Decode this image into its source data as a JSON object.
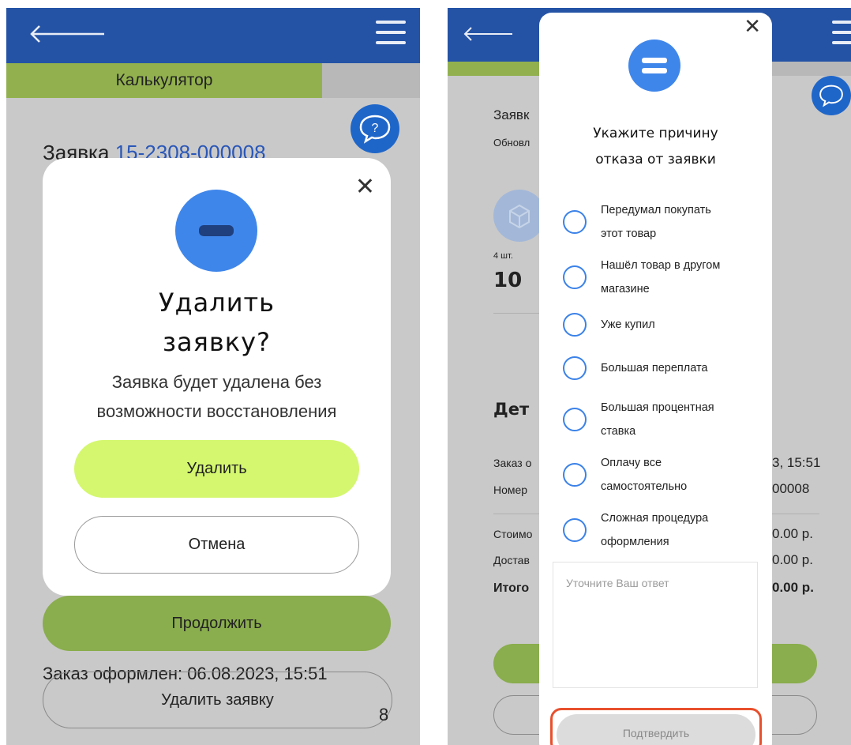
{
  "left": {
    "header": {
      "back_icon": "arrow-left-icon",
      "menu_icon": "hamburger-menu-icon"
    },
    "calc_tab": "Калькулятор",
    "bg": {
      "order_prefix": "Заявка",
      "order_number": "15-2308-000008",
      "continue_label": "Продолжить",
      "order_placed_fragment": "Заказ оформлен: 06.08.2023, 15:51",
      "delete_order_label": "Удалить заявку",
      "trailing_char": "8"
    },
    "modal": {
      "title": "Удалить заявку?",
      "description": "Заявка будет удалена без возможности восстановления",
      "delete_label": "Удалить",
      "cancel_label": "Отмена"
    }
  },
  "right": {
    "bg": {
      "order_fragment": "Заявк",
      "updated_fragment": "Обновл",
      "qty": "4 шт.",
      "price_fragment": "10",
      "details_fragment": "Дет",
      "order_row_fragment": "Заказ о",
      "order_row_value": "3, 15:51",
      "number_row_fragment": "Номер",
      "number_row_value": "00008",
      "cost_fragment": "Стоимо",
      "cost_value": "0.00 р.",
      "delivery_fragment": "Достав",
      "delivery_value": "0.00 р.",
      "total_fragment": "Итого",
      "total_value": "0.00 р."
    },
    "modal": {
      "title_line1": "Укажите причину",
      "title_line2": "отказа от заявки",
      "reasons": [
        {
          "line1": "Передумал покупать",
          "line2": "этот товар"
        },
        {
          "line1": "Нашёл товар в другом",
          "line2": "магазине"
        },
        {
          "line1": "Уже купил",
          "line2": ""
        },
        {
          "line1": "Большая переплата",
          "line2": ""
        },
        {
          "line1": "Большая процентная",
          "line2": "ставка"
        },
        {
          "line1": "Оплачу все",
          "line2": "самостоятельно"
        },
        {
          "line1": "Сложная процедура",
          "line2": "оформления"
        }
      ],
      "answer_placeholder": "Уточните Ваш ответ",
      "confirm_label": "Подтвердить"
    }
  },
  "colors": {
    "header_blue": "#2453a6",
    "accent_green": "#d4f76f",
    "radio_blue": "#3b82e8",
    "highlight_red": "#e8502d"
  }
}
